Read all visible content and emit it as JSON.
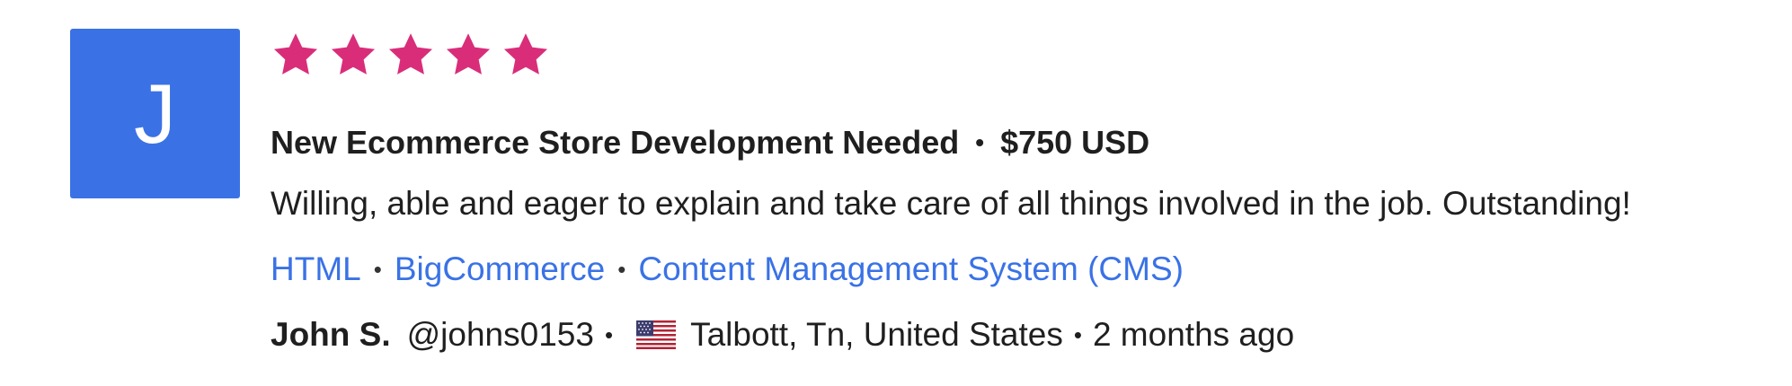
{
  "avatar": {
    "initial": "J",
    "color": "#3a72e6"
  },
  "rating": {
    "stars": 5,
    "max": 5,
    "color": "#d92d7a"
  },
  "project": {
    "title": "New Ecommerce Store Development Needed",
    "separator": "•",
    "budget": "$750 USD"
  },
  "review": {
    "comment": "Willing, able and eager to explain and take care of all things involved in the job. Outstanding!"
  },
  "skills": {
    "separator": "•",
    "items": [
      "HTML",
      "BigCommerce",
      "Content Management System (CMS)"
    ],
    "link_color": "#3a72e6"
  },
  "reviewer": {
    "name": "John S.",
    "handle": "@johns0153",
    "separator": "•",
    "flag_icon": "us-flag-icon",
    "location": "Talbott, Tn, United States",
    "time_ago": "2 months ago"
  }
}
